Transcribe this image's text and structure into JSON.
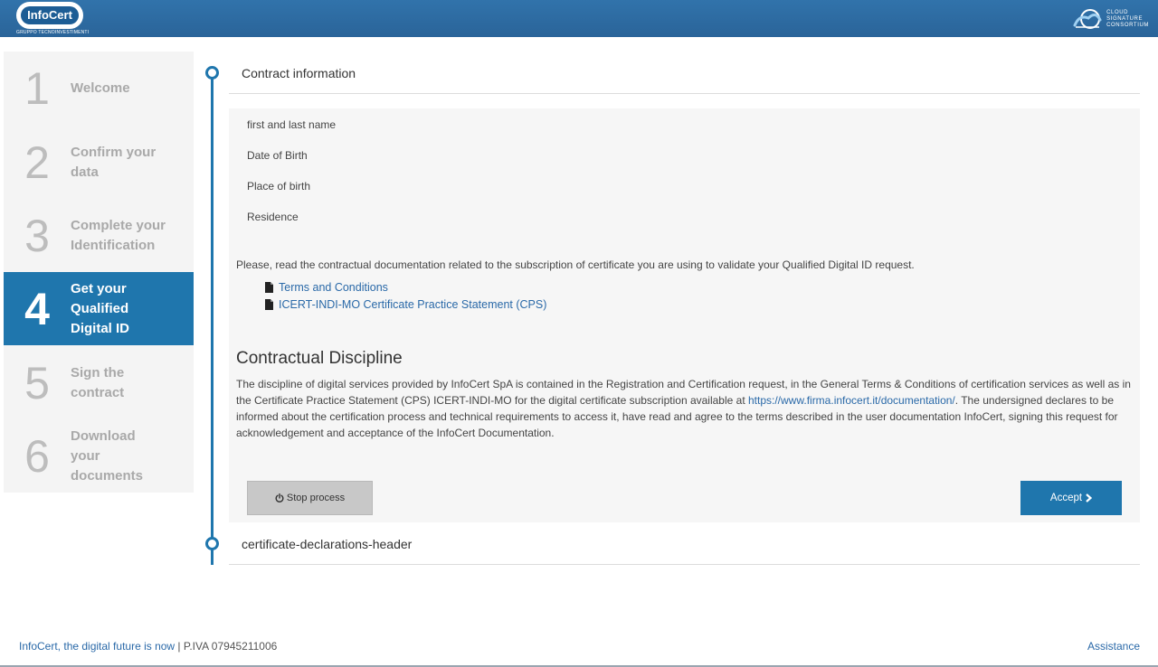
{
  "header": {
    "logo_text": "InfoCert",
    "logo_subtitle": "GRUPPO TECNOINVESTIMENTI",
    "partner_lines": [
      "CLOUD",
      "SIGNATURE",
      "CONSORTIUM"
    ]
  },
  "steps": [
    {
      "num": "1",
      "label_lines": [
        "Welcome"
      ],
      "active": false
    },
    {
      "num": "2",
      "label_lines": [
        "Confirm your",
        "data"
      ],
      "active": false
    },
    {
      "num": "3",
      "label_lines": [
        "Complete your",
        "Identification"
      ],
      "active": false
    },
    {
      "num": "4",
      "label_lines": [
        "Get your",
        "Qualified",
        "Digital ID"
      ],
      "active": true
    },
    {
      "num": "5",
      "label_lines": [
        "Sign the",
        "contract"
      ],
      "active": false
    },
    {
      "num": "6",
      "label_lines": [
        "Download",
        "your",
        "documents"
      ],
      "active": false
    }
  ],
  "contract": {
    "title": "Contract information",
    "fields": [
      "first and last name",
      "Date of Birth",
      "Place of birth",
      "Residence"
    ],
    "intro": "Please, read the contractual documentation related to the subscription of certificate you are using to validate your Qualified Digital ID request.",
    "docs": [
      "Terms and Conditions",
      "ICERT-INDI-MO Certificate Practice Statement (CPS)"
    ],
    "discipline_title": "Contractual Discipline",
    "discipline_text_1": "The discipline of digital services provided by InfoCert SpA is contained in the Registration and Certification request, in the General Terms & Conditions of certification services as well as in the Certificate Practice Statement (CPS) ICERT-INDI-MO for the digital certificate subscription available at ",
    "discipline_link": "https://www.firma.infocert.it/documentation/",
    "discipline_text_2": ". The undersigned declares to be informed about the certification process and technical requirements to access it, have read and agree to the terms described in the user documentation InfoCert, signing this request for acknowledgement and acceptance of the InfoCert Documentation.",
    "stop_label": "Stop process",
    "accept_label": "Accept"
  },
  "declarations": {
    "title": "certificate-declarations-header"
  },
  "footer": {
    "slogan": "InfoCert, the digital future is now",
    "vat": " | P.IVA 07945211006",
    "assistance": "Assistance"
  },
  "colors": {
    "brand_blue": "#1f76ad",
    "header_blue": "#2b6aa0",
    "link_blue": "#2a69a8"
  }
}
